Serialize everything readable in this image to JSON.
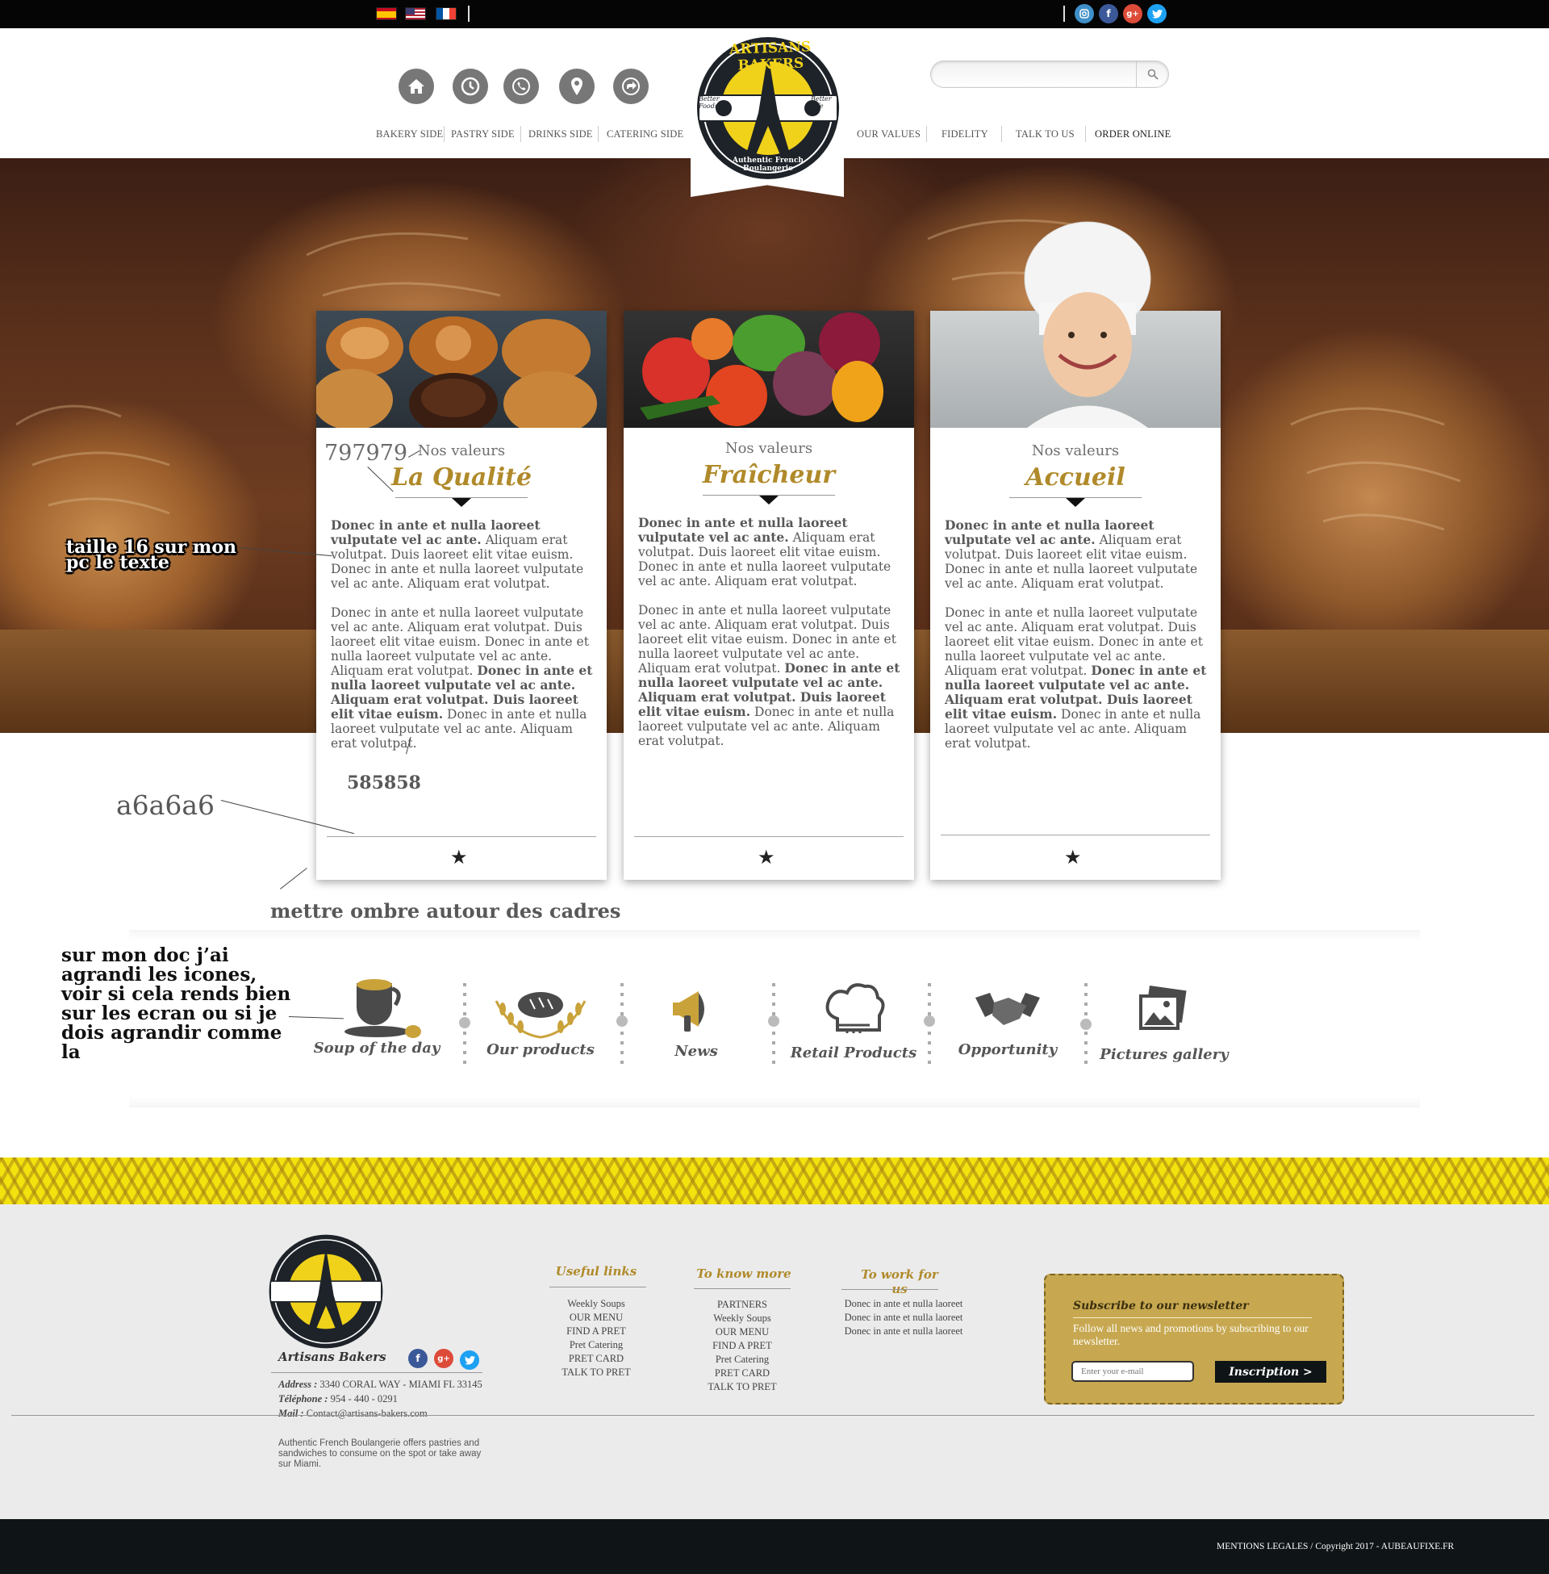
{
  "topbar": {
    "flags": [
      "spain-flag-icon",
      "usa-flag-icon",
      "france-flag-icon"
    ],
    "social": [
      "instagram-icon",
      "facebook-icon",
      "google-plus-icon",
      "twitter-icon"
    ]
  },
  "nav": {
    "left_links": [
      "BAKERY SIDE",
      "PASTRY SIDE",
      "DRINKS SIDE",
      "CATERING SIDE"
    ],
    "right_links": [
      "OUR VALUES",
      "FIDELITY",
      "TALK TO US",
      "ORDER ONLINE"
    ],
    "icons": [
      "home-icon",
      "clock-icon",
      "phone-icon",
      "location-pin-icon",
      "directions-icon"
    ]
  },
  "logo": {
    "top_text": "ARTISANS BAKERS",
    "left_text": "Better Foods",
    "right_text": "Better Life",
    "bottom_text": "Authentic French Boulangerie"
  },
  "cards": [
    {
      "subtitle": "Nos valeurs",
      "title": "La Qualité",
      "p1_bold": "Donec in ante et nulla laoreet vulputate vel ac ante.",
      "p1_rest": " Aliquam erat volutpat. Duis laoreet elit vitae euism. Donec in ante et nulla laoreet vulputate vel ac ante. Aliquam erat volutpat.",
      "p2_a": "Donec in ante et nulla laoreet vulputate vel ac ante. Aliquam erat volutpat. Duis laoreet elit vitae euism. Donec in ante et nulla laoreet vulputate vel ac ante. Aliquam erat volutpat. ",
      "p2_bold": "Donec in ante et nulla laoreet vulputate vel ac ante. Aliquam erat volutpat. Duis laoreet elit vitae euism.",
      "p2_c": " Donec in ante et nulla laoreet vulputate vel ac ante. Aliquam erat volutpat.",
      "star": "★"
    },
    {
      "subtitle": "Nos valeurs",
      "title": "Fraîcheur",
      "p1_bold": "Donec in ante et nulla laoreet vulputate vel ac ante.",
      "p1_rest": " Aliquam erat volutpat. Duis laoreet elit vitae euism. Donec in ante et nulla laoreet vulputate vel ac ante. Aliquam erat volutpat.",
      "p2_a": "Donec in ante et nulla laoreet vulputate vel ac ante. Aliquam erat volutpat. Duis laoreet elit vitae euism. Donec in ante et nulla laoreet vulputate vel ac ante. Aliquam erat volutpat. ",
      "p2_bold": "Donec in ante et nulla laoreet vulputate vel ac ante. Aliquam erat volutpat. Duis laoreet elit vitae euism.",
      "p2_c": " Donec in ante et nulla laoreet vulputate vel ac ante. Aliquam erat volutpat.",
      "star": "★"
    },
    {
      "subtitle": "Nos valeurs",
      "title": "Accueil",
      "p1_bold": "Donec in ante et nulla laoreet vulputate vel ac ante.",
      "p1_rest": " Aliquam erat volutpat. Duis laoreet elit vitae euism. Donec in ante et nulla laoreet vulputate vel ac ante. Aliquam erat volutpat.",
      "p2_a": "Donec in ante et nulla laoreet vulputate vel ac ante. Aliquam erat volutpat. Duis laoreet elit vitae euism. Donec in ante et nulla laoreet vulputate vel ac ante. Aliquam erat volutpat. ",
      "p2_bold": "Donec in ante et nulla laoreet vulputate vel ac ante. Aliquam erat volutpat. Duis laoreet elit vitae euism.",
      "p2_c": " Donec in ante et nulla laoreet vulputate vel ac ante. Aliquam erat volutpat.",
      "star": "★"
    }
  ],
  "annotations": {
    "color_title": "797979",
    "font_size_note": "taille 16 sur mon pc le texte",
    "color_text": "585858",
    "color_rule": "a6a6a6",
    "shadow_note": "mettre ombre autour des cadres",
    "icons_note": "sur mon doc j’ai agrandi les icones, voir si cela rends bien sur les ecran ou si je dois agrandir comme la"
  },
  "features": [
    {
      "label": "Soup of the day",
      "icon": "soup-cup-icon"
    },
    {
      "label": "Our products",
      "icon": "bread-wheat-icon"
    },
    {
      "label": "News",
      "icon": "megaphone-icon"
    },
    {
      "label": "Retail Products",
      "icon": "chef-hat-icon"
    },
    {
      "label": "Opportunity",
      "icon": "handshake-icon"
    },
    {
      "label": "Pictures gallery",
      "icon": "gallery-icon"
    }
  ],
  "footer": {
    "brand": "Artisans Bakers",
    "address_label": "Address :",
    "address": "3340 CORAL WAY - MIAMI FL 33145",
    "phone_label": "Téléphone :",
    "phone": "954 - 440 - 0291",
    "mail_label": "Mail :",
    "mail": "Contact@artisans-bakers.com",
    "description": "Authentic French Boulangerie offers pastries and sandwiches to consume on the spot or take away sur Miami.",
    "useful_links": {
      "title": "Useful links",
      "items": [
        "Weekly Soups",
        "OUR MENU",
        "FIND A PRET",
        "Pret Catering",
        "PRET CARD",
        "TALK TO PRET"
      ]
    },
    "know_more": {
      "title": "To know more",
      "items": [
        "PARTNERS",
        "Weekly Soups",
        "OUR MENU",
        "FIND A PRET",
        "Pret Catering",
        "PRET CARD",
        "TALK TO PRET"
      ]
    },
    "work": {
      "title": "To work for us",
      "items": [
        "Donec in ante et nulla laoreet",
        "Donec in ante et nulla laoreet",
        "Donec in ante et nulla laoreet"
      ]
    },
    "newsletter": {
      "title": "Subscribe to our newsletter",
      "text": "Follow all news and promotions by subscribing to our newsletter.",
      "placeholder": "Enter your e-mail",
      "button": "Inscription >"
    },
    "copyright": "MENTIONS LEGALES / Copyright 2017 - AUBEAUFIXE.FR"
  },
  "colors": {
    "gold": "#b08a2a",
    "yellow": "#f2e20e",
    "dark": "#0f1416"
  }
}
